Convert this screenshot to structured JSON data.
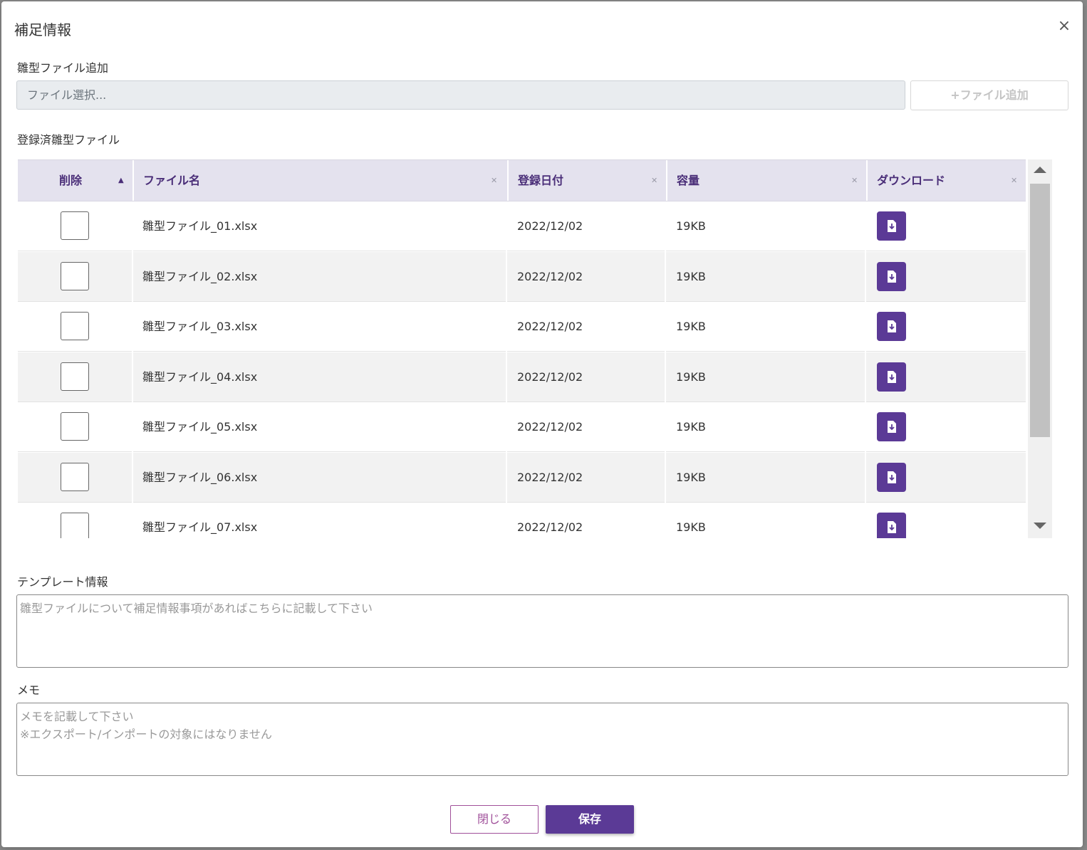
{
  "dialog": {
    "title": "補足情報",
    "close_symbol": "×"
  },
  "upload": {
    "label": "雛型ファイル追加",
    "placeholder": "ファイル選択...",
    "add_button": "+ファイル追加"
  },
  "registered": {
    "label": "登録済雛型ファイル",
    "columns": [
      "削除",
      "ファイル名",
      "登録日付",
      "容量",
      "ダウンロード"
    ],
    "rows": [
      {
        "name": "雛型ファイル_01.xlsx",
        "date": "2022/12/02",
        "size": "19KB"
      },
      {
        "name": "雛型ファイル_02.xlsx",
        "date": "2022/12/02",
        "size": "19KB"
      },
      {
        "name": "雛型ファイル_03.xlsx",
        "date": "2022/12/02",
        "size": "19KB"
      },
      {
        "name": "雛型ファイル_04.xlsx",
        "date": "2022/12/02",
        "size": "19KB"
      },
      {
        "name": "雛型ファイル_05.xlsx",
        "date": "2022/12/02",
        "size": "19KB"
      },
      {
        "name": "雛型ファイル_06.xlsx",
        "date": "2022/12/02",
        "size": "19KB"
      },
      {
        "name": "雛型ファイル_07.xlsx",
        "date": "2022/12/02",
        "size": "19KB"
      }
    ]
  },
  "template_info": {
    "label": "テンプレート情報",
    "placeholder": "雛型ファイルについて補足情報事項があればこちらに記載して下さい"
  },
  "memo": {
    "label": "メモ",
    "placeholder": "メモを記載して下さい\n※エクスポート/インポートの対象にはなりません"
  },
  "footer": {
    "close_label": "閉じる",
    "save_label": "保存"
  },
  "colors": {
    "accent": "#5b3a96",
    "header_bg": "#e4e2ee",
    "close_border": "#a0509a"
  },
  "icons": {
    "download": "file-download-icon",
    "close": "close-icon"
  }
}
